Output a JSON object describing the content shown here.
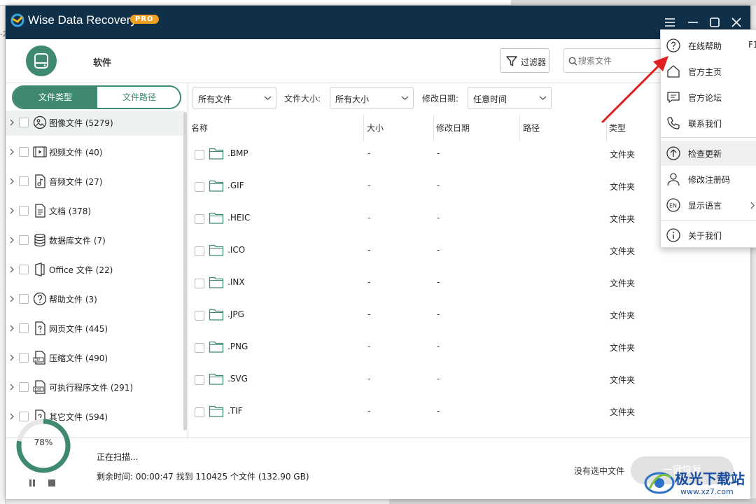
{
  "background": {
    "stub_text": "-2"
  },
  "app": {
    "title": "Wise Data Recovery",
    "badge": "PRO"
  },
  "header": {
    "drive_label": "软件",
    "filter_label": "过滤器",
    "search_placeholder": "搜索文件"
  },
  "sidebar": {
    "tabs": [
      {
        "label": "文件类型",
        "active": true
      },
      {
        "label": "文件路径",
        "active": false
      }
    ],
    "items": [
      {
        "label": "图像文件 (5279)",
        "icon": "image-icon",
        "selected": true
      },
      {
        "label": "视频文件 (40)",
        "icon": "video-icon"
      },
      {
        "label": "音频文件 (27)",
        "icon": "audio-icon"
      },
      {
        "label": "文档 (378)",
        "icon": "document-icon"
      },
      {
        "label": "数据库文件 (7)",
        "icon": "database-icon"
      },
      {
        "label": "Office 文件 (22)",
        "icon": "office-icon"
      },
      {
        "label": "帮助文件 (3)",
        "icon": "help-file-icon"
      },
      {
        "label": "网页文件 (445)",
        "icon": "web-file-icon"
      },
      {
        "label": "压缩文件 (490)",
        "icon": "zip-icon"
      },
      {
        "label": "可执行程序文件 (291)",
        "icon": "exe-icon"
      },
      {
        "label": "其它文件 (594)",
        "icon": "other-file-icon"
      }
    ]
  },
  "filters": {
    "type_value": "所有文件",
    "size_label": "文件大小:",
    "size_value": "所有大小",
    "date_label": "修改日期:",
    "date_value": "任意时间"
  },
  "table": {
    "columns": [
      "名称",
      "大小",
      "修改日期",
      "路径",
      "类型"
    ],
    "rows": [
      {
        "name": ".BMP",
        "size": "-",
        "date": "-",
        "type": "文件夹"
      },
      {
        "name": ".GIF",
        "size": "-",
        "date": "-",
        "type": "文件夹"
      },
      {
        "name": ".HEIC",
        "size": "-",
        "date": "-",
        "type": "文件夹"
      },
      {
        "name": ".ICO",
        "size": "-",
        "date": "-",
        "type": "文件夹"
      },
      {
        "name": ".INX",
        "size": "-",
        "date": "-",
        "type": "文件夹"
      },
      {
        "name": ".JPG",
        "size": "-",
        "date": "-",
        "type": "文件夹"
      },
      {
        "name": ".PNG",
        "size": "-",
        "date": "-",
        "type": "文件夹"
      },
      {
        "name": ".SVG",
        "size": "-",
        "date": "-",
        "type": "文件夹"
      },
      {
        "name": ".TIF",
        "size": "-",
        "date": "-",
        "type": "文件夹"
      }
    ]
  },
  "status": {
    "progress_value": 0.78,
    "progress_text": "78%",
    "scanning": "正在扫描...",
    "detail": "剩余时间: 00:00:47 找到 110425 个文件 (132.90 GB)",
    "no_selection": "没有选中文件",
    "recover_button": "一键恢复"
  },
  "menu": {
    "items": [
      {
        "label": "在线帮助",
        "icon": "help-circle-icon",
        "shortcut": "F1"
      },
      {
        "label": "官方主页",
        "icon": "home-icon"
      },
      {
        "label": "官方论坛",
        "icon": "forum-icon"
      },
      {
        "label": "联系我们",
        "icon": "phone-icon"
      },
      {
        "label": "检查更新",
        "icon": "update-icon",
        "highlighted": true
      },
      {
        "label": "修改注册码",
        "icon": "user-icon"
      },
      {
        "label": "显示语言",
        "icon": "language-icon",
        "icon_text": "EN",
        "has_submenu": true
      },
      {
        "label": "关于我们",
        "icon": "info-icon"
      }
    ]
  },
  "watermark": {
    "text": "极光下载站",
    "url": "www.xz7.com"
  },
  "colors": {
    "titlebar": "#0f3048",
    "accent": "#3f8a6f",
    "pro_badge": "#f0a020",
    "arrow": "#e02020"
  }
}
